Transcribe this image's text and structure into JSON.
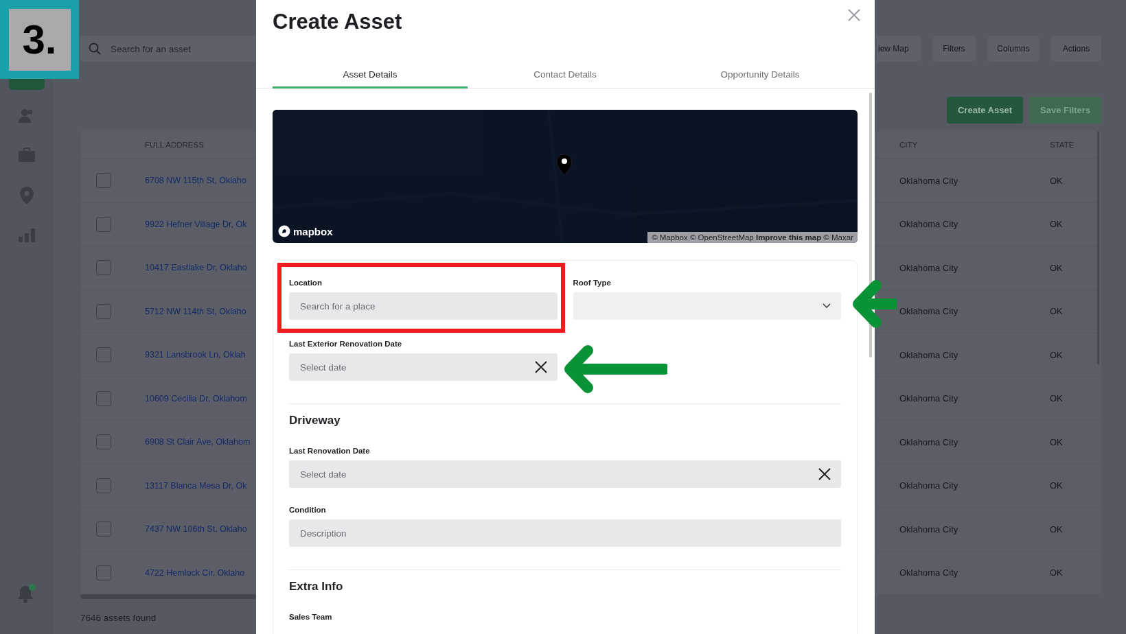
{
  "step_badge": "3.",
  "page": {
    "search": {
      "placeholder": "Search for an asset"
    },
    "toolbar": [
      "iew Map",
      "Filters",
      "Columns",
      "Actions"
    ],
    "actions": [
      {
        "label": "Create Asset",
        "disabled": false
      },
      {
        "label": "Save Filters",
        "disabled": true
      }
    ],
    "table": {
      "columns": [
        "FULL ADDRESS",
        "CITY",
        "STATE"
      ],
      "rows": [
        {
          "checked": false,
          "address": "6708 NW 115th St, Oklaho",
          "city": "Oklahoma City",
          "state": "OK"
        },
        {
          "checked": false,
          "address": "9922 Hefner Village Dr, Ok",
          "city": "Oklahoma City",
          "state": "OK"
        },
        {
          "checked": false,
          "address": "10417 Eastlake Dr, Oklaho",
          "city": "Oklahoma City",
          "state": "OK"
        },
        {
          "checked": false,
          "address": "5712 NW 114th St, Oklaho",
          "city": "Oklahoma City",
          "state": "OK"
        },
        {
          "checked": false,
          "address": "9321 Lansbrook Ln, Oklah",
          "city": "Oklahoma City",
          "state": "OK"
        },
        {
          "checked": false,
          "address": "10609 Cecilia Dr, Oklahom",
          "city": "Oklahoma City",
          "state": "OK"
        },
        {
          "checked": false,
          "address": "6908 St Clair Ave, Oklahom",
          "city": "Oklahoma City",
          "state": "OK"
        },
        {
          "checked": false,
          "address": "13117 Blanca Mesa Dr, Ok",
          "city": "Oklahoma City",
          "state": "OK"
        },
        {
          "checked": false,
          "address": "7437 NW 106th St, Oklaho",
          "city": "Oklahoma City",
          "state": "OK"
        },
        {
          "checked": false,
          "address": "4722 Hemlock Cir, Oklaho",
          "city": "Oklahoma City",
          "state": "OK"
        }
      ]
    },
    "footer": "7646 assets found"
  },
  "modal": {
    "title": "Create Asset",
    "tabs": [
      {
        "label": "Asset Details",
        "selected": true
      },
      {
        "label": "Contact Details",
        "selected": false
      },
      {
        "label": "Opportunity Details",
        "selected": false
      }
    ],
    "map": {
      "kind": "picture",
      "logo": "mapbox",
      "attribution": "© Mapbox © OpenStreetMap **Improve this map** © Maxar"
    },
    "groups": [
      {
        "kind": "columns",
        "fields": [
          {
            "kind": "text",
            "label": "Location",
            "placeholder": "Search for a place"
          },
          {
            "kind": "select",
            "label": "Roof Type"
          },
          {
            "kind": "date",
            "label": "Last Exterior Renovation Date",
            "placeholder": "Select date"
          }
        ]
      },
      {
        "kind": "stack",
        "heading": "Driveway",
        "fields": [
          {
            "kind": "date",
            "label": "Last Renovation Date",
            "placeholder": "Select date"
          },
          {
            "kind": "text",
            "label": "Condition",
            "placeholder": "Description"
          }
        ]
      },
      {
        "kind": "stack",
        "heading": "Extra Info",
        "fields": [
          {
            "kind": "label",
            "label": "Sales Team"
          }
        ]
      }
    ]
  }
}
